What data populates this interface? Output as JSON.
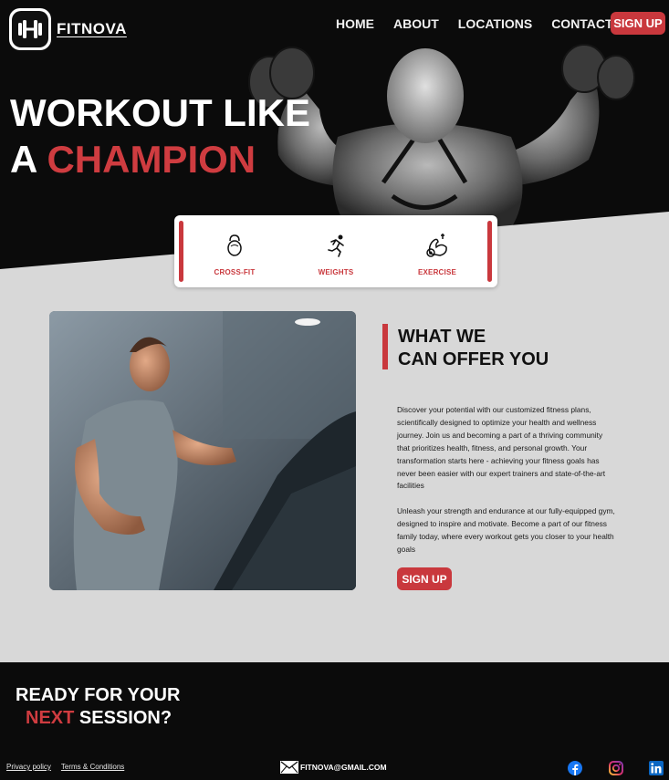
{
  "brand": {
    "name": "FITNOVA",
    "logo_icon": "dumbbell-icon"
  },
  "nav": {
    "items": [
      "HOME",
      "ABOUT",
      "LOCATIONS",
      "CONTACT"
    ],
    "signup_label": "SIGN UP"
  },
  "hero": {
    "line1": "WORKOUT LIKE",
    "line2_prefix": "A ",
    "line2_accent": "CHAMPION"
  },
  "features": [
    {
      "label": "CROSS-FIT",
      "icon": "kettlebell-icon"
    },
    {
      "label": "WEIGHTS",
      "icon": "runner-icon"
    },
    {
      "label": "EXERCISE",
      "icon": "flexed-arm-icon"
    }
  ],
  "offer": {
    "title_line1": "WHAT WE",
    "title_line2": "CAN OFFER YOU",
    "paragraph1": "Discover your potential with our customized fitness plans, scientifically designed to optimize your health and wellness journey. Join us and becoming a part of a thriving community that prioritizes health, fitness, and personal growth. Your transformation starts here - achieving your fitness goals has never been easier with our expert trainers and state-of-the-art facilities",
    "paragraph2": "Unleash your strength and endurance at our fully-equipped gym, designed to inspire and motivate. Become a part of our fitness family today, where every workout gets you closer to your health goals",
    "signup_label": "SIGN UP"
  },
  "footer": {
    "ready_line1": "READY FOR YOUR",
    "ready_accent": "NEXT",
    "ready_rest": " SESSION?",
    "privacy": "Privacy policy",
    "terms": "Terms & Conditions",
    "email": "FITNOVA@GMAIL.COM",
    "socials": [
      "facebook-icon",
      "instagram-icon",
      "linkedin-icon"
    ]
  },
  "colors": {
    "accent": "#c9383d",
    "dark": "#0b0b0b",
    "light": "#d8d8d8"
  }
}
